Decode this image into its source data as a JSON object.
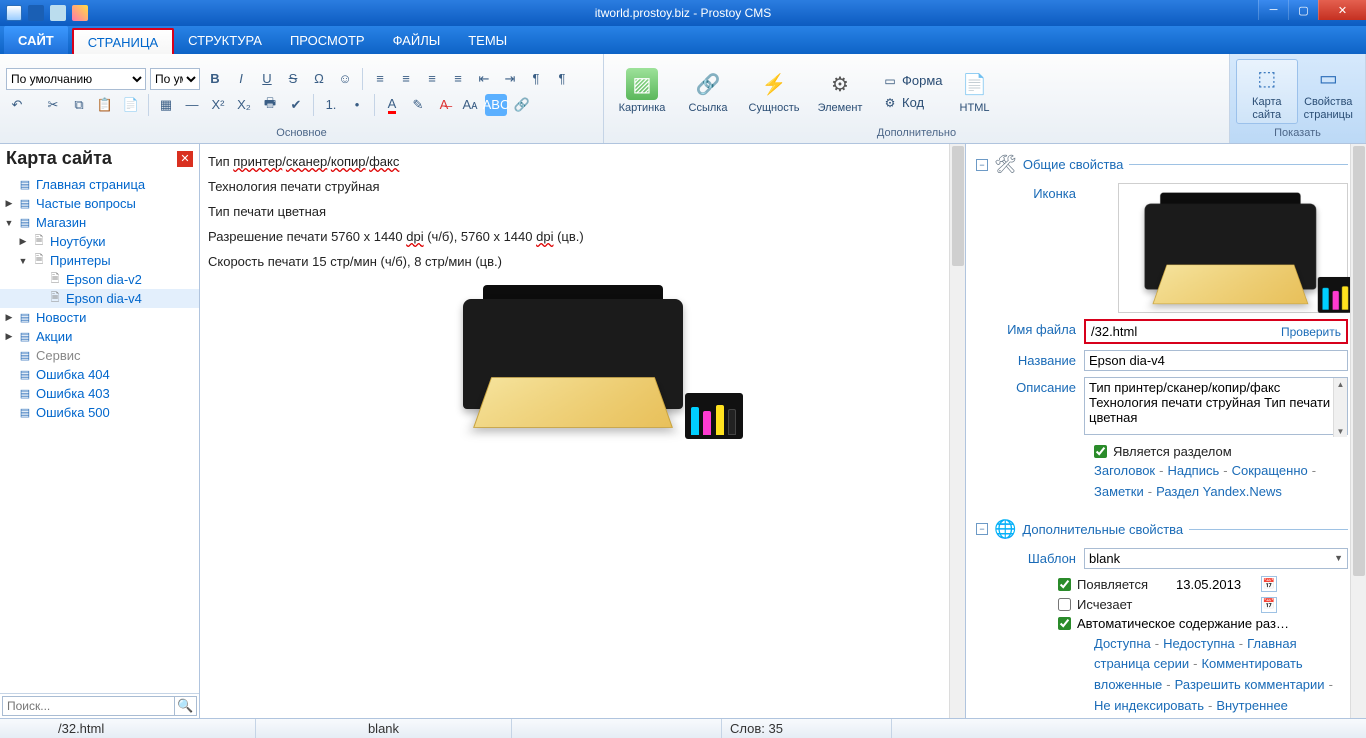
{
  "title": "itworld.prostoy.biz - Prostoy CMS",
  "menu": {
    "site": "САЙТ",
    "page": "СТРАНИЦА",
    "structure": "СТРУКТУРА",
    "preview": "ПРОСМОТР",
    "files": "ФАЙЛЫ",
    "themes": "ТЕМЫ"
  },
  "ribbon": {
    "style_default": "По умолчанию",
    "font_placeholder": "По ум",
    "group_main": "Основное",
    "group_extra": "Дополнительно",
    "group_show": "Показать",
    "btn_picture": "Картинка",
    "btn_link": "Ссылка",
    "btn_entity": "Сущность",
    "btn_element": "Элемент",
    "btn_form": "Форма",
    "btn_code": "Код",
    "btn_html": "HTML",
    "btn_sitemap": "Карта сайта",
    "btn_pageprops": "Свойства страницы"
  },
  "sitemap": {
    "title": "Карта сайта",
    "items": [
      {
        "id": "home",
        "label": "Главная страница",
        "icon": "page",
        "indent": 0
      },
      {
        "id": "faq",
        "label": "Частые вопросы",
        "icon": "page",
        "indent": 0,
        "expander": "▶"
      },
      {
        "id": "shop",
        "label": "Магазин",
        "icon": "page",
        "indent": 0,
        "expander": "▼"
      },
      {
        "id": "laptops",
        "label": "Ноутбуки",
        "icon": "file",
        "indent": 1,
        "expander": "▶"
      },
      {
        "id": "printers",
        "label": "Принтеры",
        "icon": "file",
        "indent": 1,
        "expander": "▼"
      },
      {
        "id": "epson2",
        "label": "Epson dia-v2",
        "icon": "file",
        "indent": 2
      },
      {
        "id": "epson4",
        "label": "Epson dia-v4",
        "icon": "file",
        "indent": 2,
        "selected": true
      },
      {
        "id": "news",
        "label": "Новости",
        "icon": "page",
        "indent": 0,
        "expander": "▶"
      },
      {
        "id": "promo",
        "label": "Акции",
        "icon": "page",
        "indent": 0,
        "expander": "▶"
      },
      {
        "id": "service",
        "label": "Сервис",
        "icon": "page",
        "indent": 0,
        "muted": true
      },
      {
        "id": "404",
        "label": "Ошибка 404",
        "icon": "page",
        "indent": 0
      },
      {
        "id": "403",
        "label": "Ошибка 403",
        "icon": "page",
        "indent": 0
      },
      {
        "id": "500",
        "label": "Ошибка 500",
        "icon": "page",
        "indent": 0
      }
    ],
    "search_placeholder": "Поиск..."
  },
  "content": {
    "l1_a": "Тип ",
    "l1_b": "принтер",
    "l1_c": "/",
    "l1_d": "сканер",
    "l1_e": "/",
    "l1_f": "копир",
    "l1_g": "/",
    "l1_h": "факс",
    "l2": "Технология печати струйная",
    "l3": "Тип печати цветная",
    "l4_a": "Разрешение печати 5760 x 1440 ",
    "l4_b": "dpi",
    "l4_c": " (ч/б), 5760 x 1440 ",
    "l4_d": "dpi",
    "l4_e": " (цв.)",
    "l5": "Скорость печати 15 стр/мин (ч/б), 8 стр/мин (цв.)"
  },
  "props": {
    "section1": "Общие свойства",
    "section2": "Дополнительные свойства",
    "icon_label": "Иконка",
    "filename_label": "Имя файла",
    "filename_value": "/32.html",
    "check_btn": "Проверить",
    "title_label": "Название",
    "title_value": "Epson dia-v4",
    "desc_label": "Описание",
    "desc_value": "Тип принтер/сканер/копир/факс Технология печати струйная Тип печати цветная",
    "is_section": "Является разделом",
    "links1": [
      "Заголовок",
      "Надпись",
      "Сокращенно",
      "Заметки",
      "Раздел Yandex.News"
    ],
    "tpl_label": "Шаблон",
    "tpl_value": "blank",
    "appears": "Появляется",
    "appears_date": "13.05.2013",
    "disappears": "Исчезает",
    "auto_toc": "Автоматическое содержание раз…",
    "links2": [
      "Доступна",
      "Недоступна",
      "Главная страница серии",
      "Комментировать вложенные",
      "Разрешить комментарии",
      "Не индексировать",
      "Внутреннее"
    ]
  },
  "status": {
    "path": "/32.html",
    "template": "blank",
    "words": "Слов: 35"
  }
}
